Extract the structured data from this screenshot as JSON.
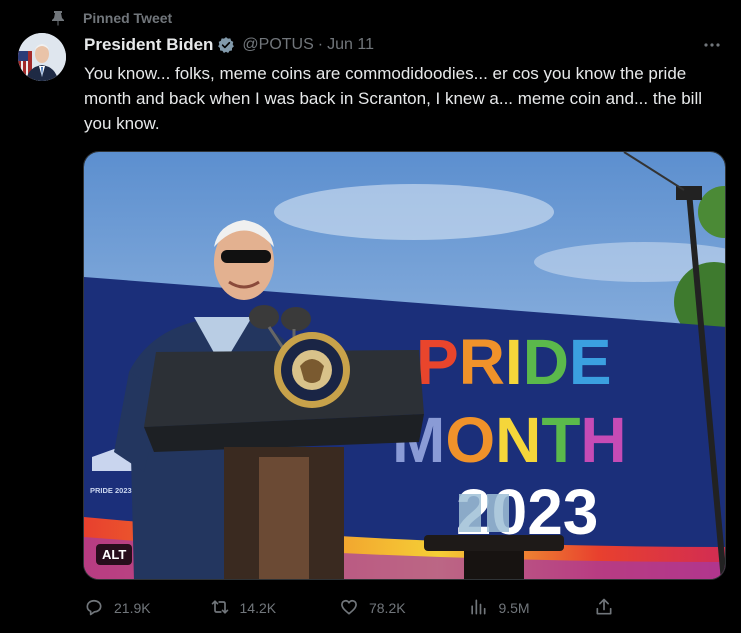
{
  "pinned": {
    "label": "Pinned Tweet",
    "icon": "pin-icon"
  },
  "author": {
    "name": "President Biden",
    "handle": "@POTUS",
    "separator": "·",
    "date": "Jun 11",
    "verified_color": "#1d9bf0"
  },
  "tweet": {
    "text": "You know... folks, meme coins are commodidoodies... er cos you know the pride month and back when I was back in Scranton, I knew a... meme coin and... the bill you know."
  },
  "media": {
    "alt_label": "ALT",
    "banner_words": [
      "PRIDE",
      "MONTH",
      "2023"
    ],
    "small_banner_text": "PRIDE 2023"
  },
  "actions": {
    "replies": "21.9K",
    "retweets": "14.2K",
    "likes": "78.2K",
    "views": "9.5M"
  },
  "colors": {
    "background": "#000000",
    "text": "#e7e9ea",
    "muted": "#71767b",
    "accent": "#1d9bf0"
  }
}
